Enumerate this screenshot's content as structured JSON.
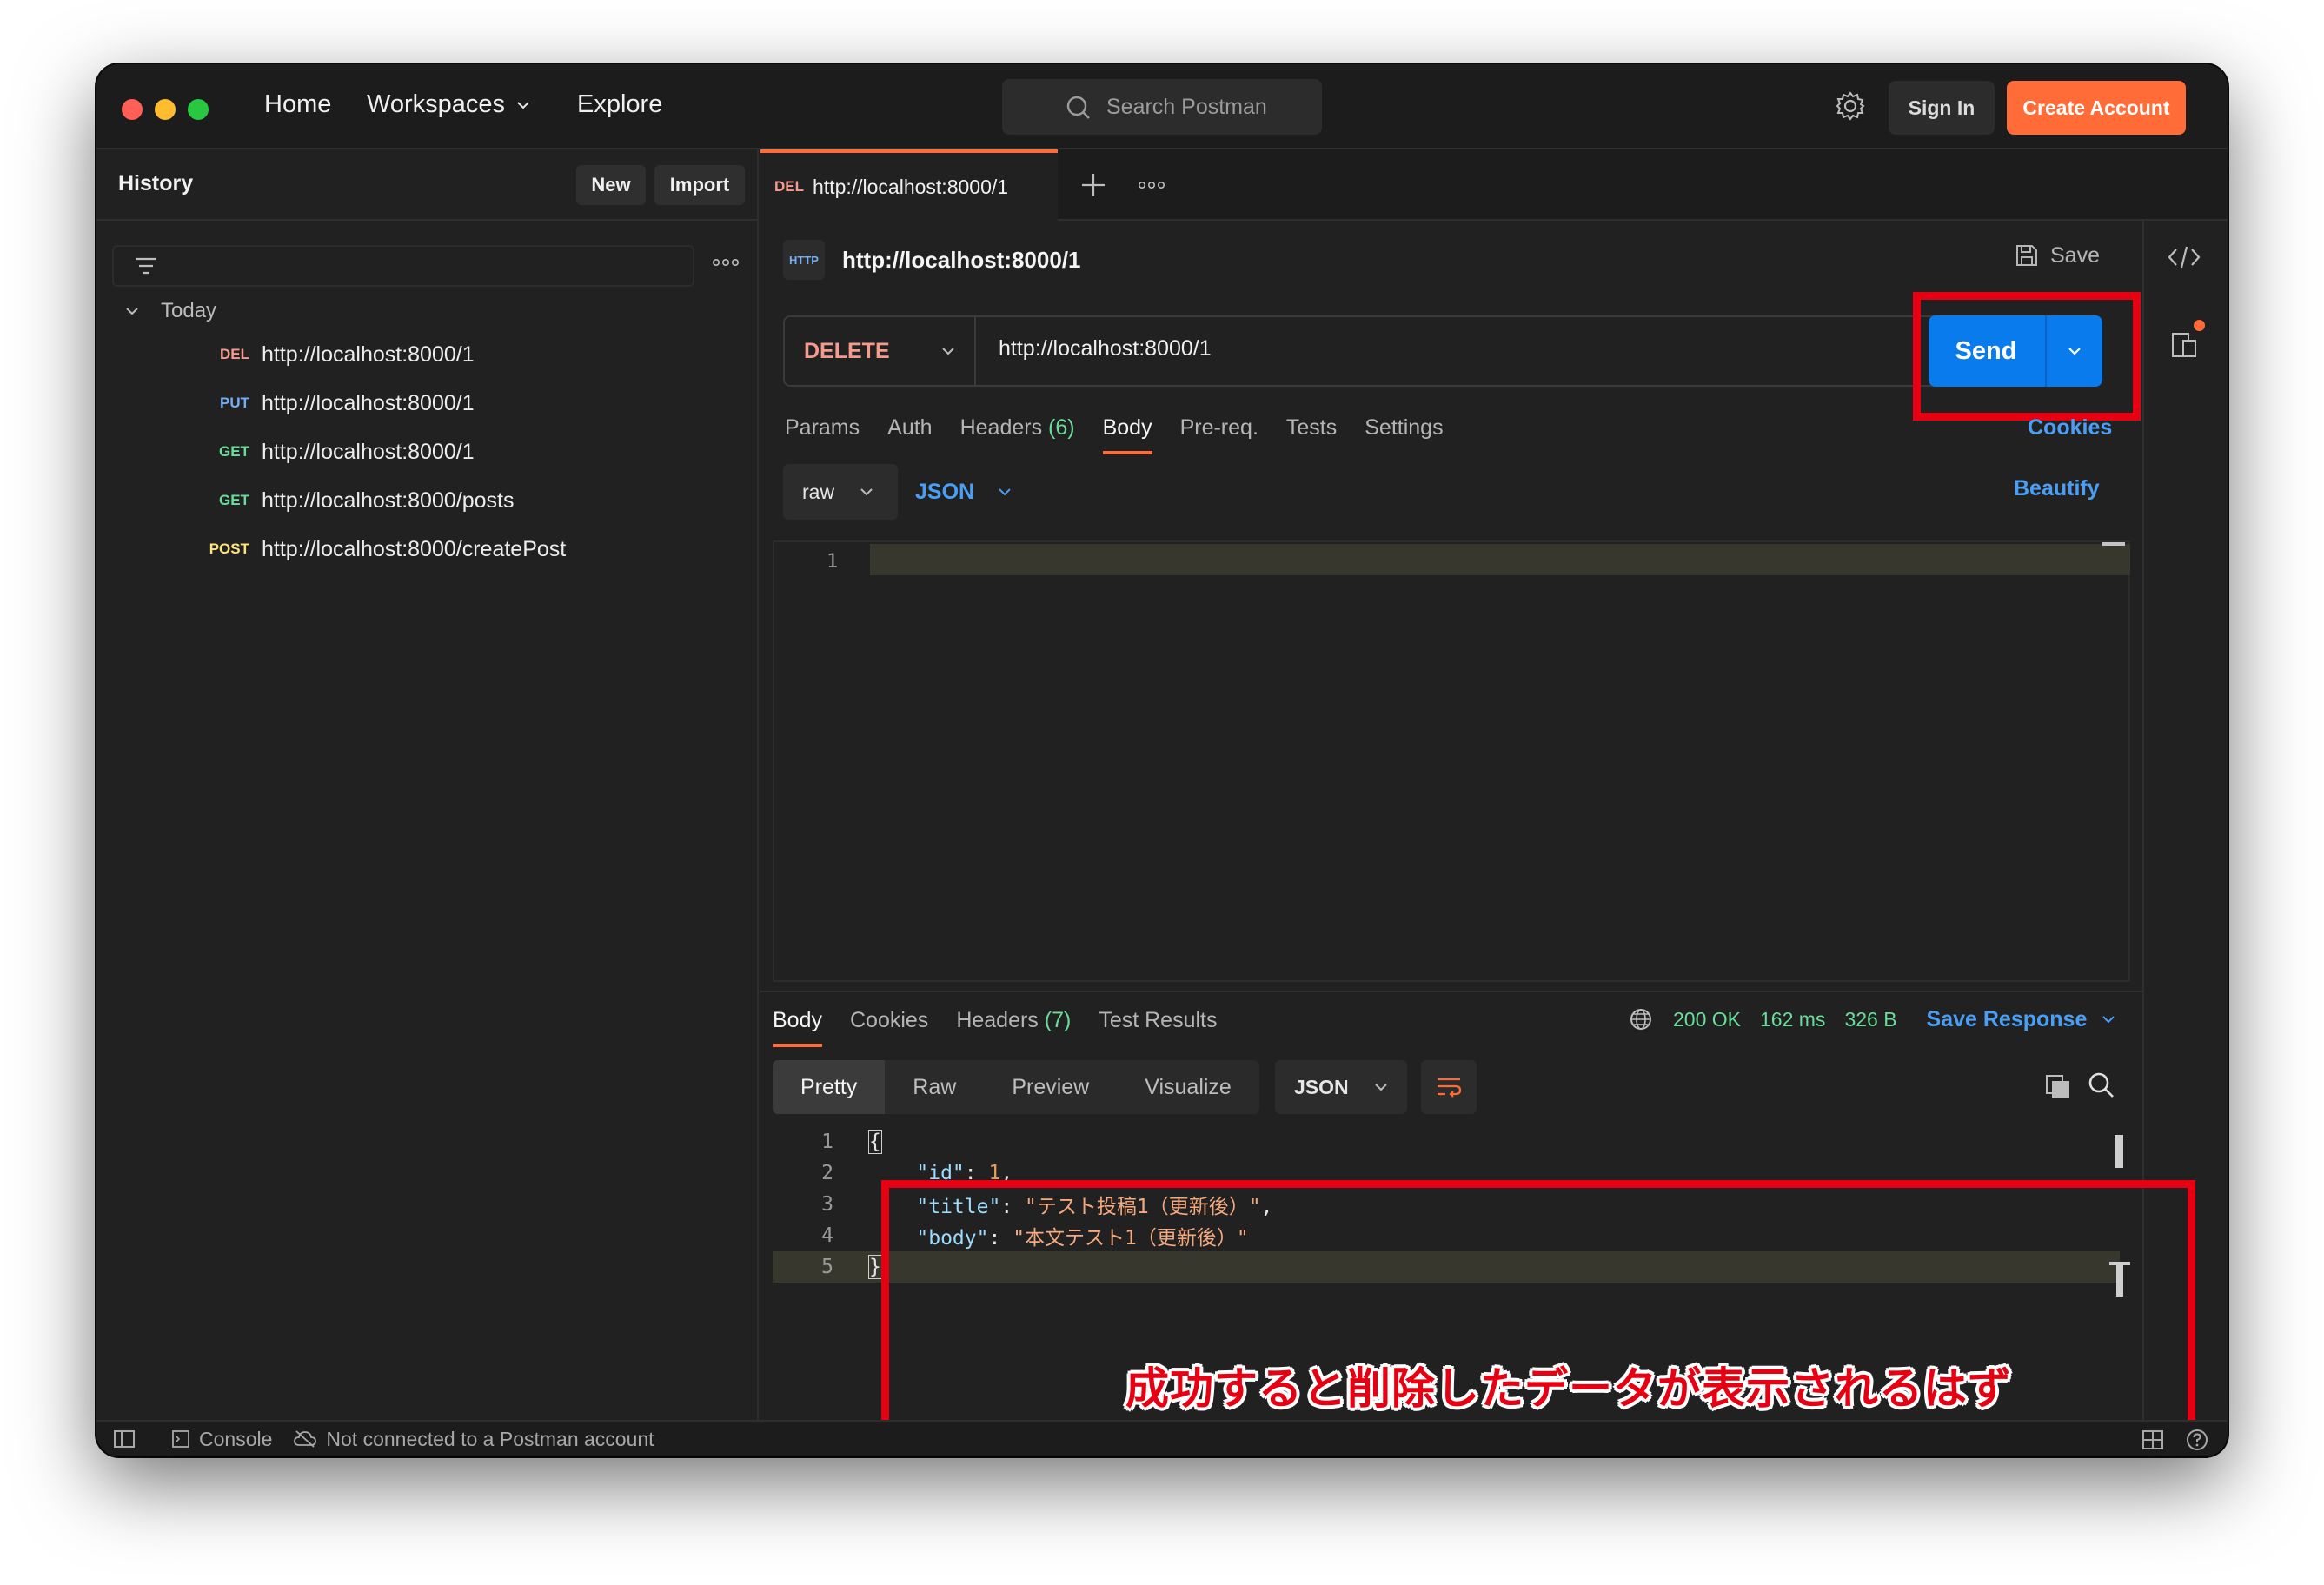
{
  "topbar": {
    "nav": [
      {
        "label": "Home"
      },
      {
        "label": "Workspaces"
      },
      {
        "label": "Explore"
      }
    ],
    "search_placeholder": "Search Postman",
    "sign_in": "Sign In",
    "create_account": "Create Account"
  },
  "sidebar": {
    "title": "History",
    "new_label": "New",
    "import_label": "Import",
    "group_label": "Today",
    "items": [
      {
        "method": "DEL",
        "url": "http://localhost:8000/1"
      },
      {
        "method": "PUT",
        "url": "http://localhost:8000/1"
      },
      {
        "method": "GET",
        "url": "http://localhost:8000/1"
      },
      {
        "method": "GET",
        "url": "http://localhost:8000/posts"
      },
      {
        "method": "POST",
        "url": "http://localhost:8000/createPost"
      }
    ]
  },
  "tab": {
    "method": "DEL",
    "url": "http://localhost:8000/1"
  },
  "request": {
    "icon_text": "HTTP",
    "title": "http://localhost:8000/1",
    "save_label": "Save",
    "method": "DELETE",
    "url": "http://localhost:8000/1",
    "send_label": "Send",
    "tabs": {
      "params": "Params",
      "auth": "Auth",
      "headers": "Headers",
      "headers_count": "(6)",
      "body": "Body",
      "prereq": "Pre-req.",
      "tests": "Tests",
      "settings": "Settings"
    },
    "cookies_label": "Cookies",
    "body_mode": "raw",
    "body_lang": "JSON",
    "beautify_label": "Beautify",
    "editor_line": "1"
  },
  "response": {
    "tabs": {
      "body": "Body",
      "cookies": "Cookies",
      "headers": "Headers",
      "headers_count": "(7)",
      "test_results": "Test Results"
    },
    "status": "200 OK",
    "time": "162 ms",
    "size": "326 B",
    "save_response": "Save Response",
    "views": {
      "pretty": "Pretty",
      "raw": "Raw",
      "preview": "Preview",
      "visualize": "Visualize"
    },
    "lang": "JSON",
    "lines": [
      {
        "no": "1",
        "open": "{"
      },
      {
        "no": "2",
        "key": "\"id\"",
        "sep": ": ",
        "val": "1",
        "tail": ","
      },
      {
        "no": "3",
        "key": "\"title\"",
        "sep": ": ",
        "val": "\"テスト投稿1（更新後）\"",
        "tail": ","
      },
      {
        "no": "4",
        "key": "\"body\"",
        "sep": ": ",
        "val": "\"本文テスト1（更新後）\"",
        "tail": ""
      },
      {
        "no": "5",
        "close": "}"
      }
    ]
  },
  "annotation": "成功すると削除したデータが表示されるはず",
  "statusbar": {
    "console": "Console",
    "connection": "Not connected to a Postman account"
  },
  "colors": {
    "accent": "#ff6c37",
    "send": "#097bed",
    "link": "#4a9ff5",
    "highlight": "#e60012"
  }
}
